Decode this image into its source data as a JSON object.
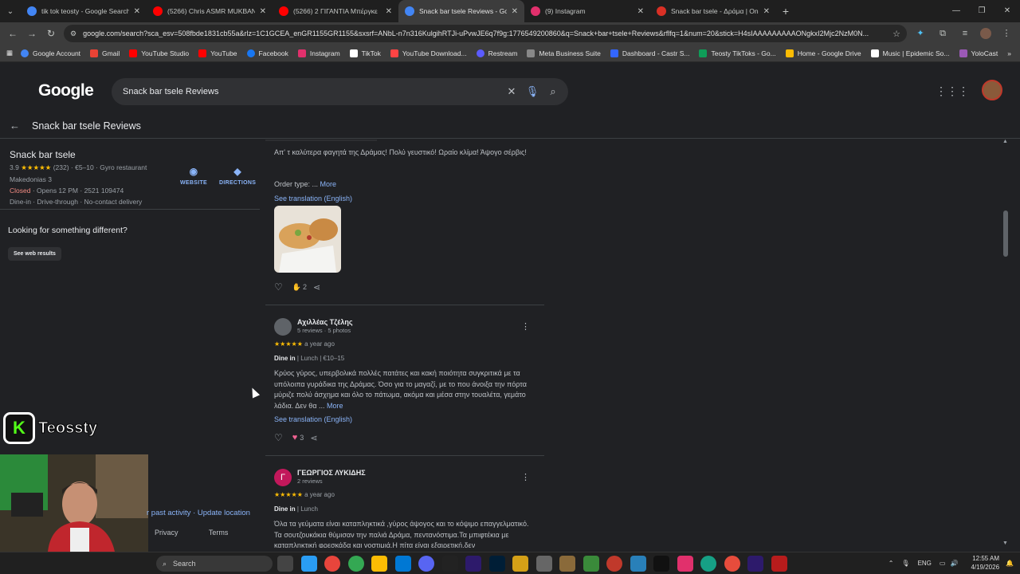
{
  "browser": {
    "tabs": [
      {
        "title": "tik tok teosty - Google Search",
        "color": "#4285f4"
      },
      {
        "title": "(5266) Chris ASMR MUKBANG |",
        "color": "#ff0000"
      },
      {
        "title": "(5266) 2 ΓΙΓΑΝΤΙΑ Μπέργκε",
        "color": "#ff0000"
      },
      {
        "title": "Snack bar tsele Reviews - Goog",
        "color": "#4285f4"
      },
      {
        "title": "(9) Instagram",
        "color": "#e1306c"
      },
      {
        "title": "Snack bar tsele - Δράμα | Onli",
        "color": "#d93025"
      }
    ],
    "url": "google.com/search?sca_esv=508fbde1831cb55a&rlz=1C1GCEA_enGR1155GR1155&sxsrf=ANbL-n7n316KulgihRTJi-uPvwJE6q7f9g:1776549200860&q=Snack+bar+tsele+Reviews&rflfq=1&num=20&stick=H4sIAAAAAAAAAONgkxI2Mjc2NzM0N...",
    "bookmarks": [
      {
        "label": "Google Account",
        "color": "#4285f4"
      },
      {
        "label": "Gmail",
        "color": "#ea4335"
      },
      {
        "label": "YouTube Studio",
        "color": "#ff0000"
      },
      {
        "label": "YouTube",
        "color": "#ff0000"
      },
      {
        "label": "Facebook",
        "color": "#1877f2"
      },
      {
        "label": "Instagram",
        "color": "#e1306c"
      },
      {
        "label": "TikTok",
        "color": "#ffffff"
      },
      {
        "label": "YouTube Download...",
        "color": "#ff4444"
      },
      {
        "label": "Restream",
        "color": "#5b5bff"
      },
      {
        "label": "Meta Business Suite",
        "color": "#888"
      },
      {
        "label": "Dashboard - Castr S...",
        "color": "#3366ff"
      },
      {
        "label": "Teosty TikToks - Go...",
        "color": "#0f9d58"
      },
      {
        "label": "Home - Google Drive",
        "color": "#fbbc04"
      },
      {
        "label": "Music | Epidemic So...",
        "color": "#ffffff"
      },
      {
        "label": "YoloCast",
        "color": "#9b59b6"
      }
    ]
  },
  "google": {
    "logo": "Google",
    "query": "Snack bar tsele Reviews",
    "panel_title": "Snack bar tsele Reviews"
  },
  "place": {
    "name": "Snack bar tsele",
    "rating": "3.9",
    "stars": "★★★★★",
    "count": "(232)",
    "price": "€5–10",
    "category": "Gyro restaurant",
    "address": "Makedonias 3",
    "status": "Closed",
    "opens": "Opens 12 PM",
    "phone": "2521 109474",
    "options": "Dine-in · Drive-through · No-contact delivery",
    "website": "WEBSITE",
    "directions": "DIRECTIONS"
  },
  "left": {
    "different": "Looking for something different?",
    "web_results": "See web results",
    "past_activity": "r past activity",
    "update_location": "Update location",
    "privacy": "Privacy",
    "terms": "Terms"
  },
  "reviews": [
    {
      "text": "Απ' τ καλύτερα φαγητά της Δράμας! Πολύ γευστικό! Ωραίο κλίμα! Άψογο σέρβις!",
      "order_type": "Order type:",
      "more": "More",
      "translation": "See translation (English)",
      "likes": "2"
    },
    {
      "name": "Αχιλλέας Τζέλης",
      "meta": "5 reviews · 5 photos",
      "time": "a year ago",
      "service": "Dine in",
      "meal": "Lunch",
      "price": "€10–15",
      "text": "Κρύος γύρος, υπερβολικά πολλές πατάτες και κακή ποιότητα συγκριτικά με τα υπόλοιπα γυράδικα της Δράμας. Όσο για το μαγαζί, με το που άνοιξα την πόρτα μύριζε πολύ άσχημα και όλο το πάτωμα, ακόμα και μέσα στην τουαλέτα, γεμάτο λάδια. Δεν θα ...",
      "more": "More",
      "translation": "See translation (English)",
      "likes": "3"
    },
    {
      "name": "ΓΕΩΡΓΙΟΣ ΛΥΚΙΔΗΣ",
      "initial": "Γ",
      "meta": "2 reviews",
      "time": "a year ago",
      "service": "Dine in",
      "meal": "Lunch",
      "text": "Όλα τα γεύματα είναι καταπληκτικά ,γύρος άψογος και το κόψιμο επαγγελματικό. Τα σουτζουκάκια θύμισαν την παλιά Δράμα, πεντανόστιμα.Τα μπιφτέκια με καταπληκτική φρεσκάδα και νοστιμιά.Η πίτα είναι εξαιρετική,δεν"
    }
  ],
  "overlay": {
    "kick_letter": "K",
    "kick_name": "Teossty"
  },
  "taskbar": {
    "search": "Search",
    "lang": "ENG",
    "time": "12:55 AM",
    "date": "4/19/2026"
  }
}
